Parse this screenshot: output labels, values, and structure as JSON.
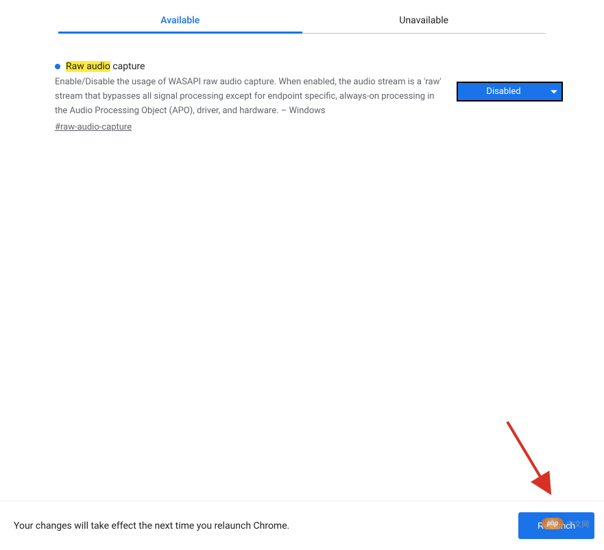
{
  "tabs": {
    "available": "Available",
    "unavailable": "Unavailable"
  },
  "flag": {
    "title_highlight": "Raw audio",
    "title_rest": " capture",
    "description": "Enable/Disable the usage of WASAPI raw audio capture. When enabled, the audio stream is a 'raw' stream that bypasses all signal processing except for endpoint specific, always-on processing in the Audio Processing Object (APO), driver, and hardware. – Windows",
    "anchor": "#raw-audio-capture",
    "selected_option": "Disabled"
  },
  "footer": {
    "message": "Your changes will take effect the next time you relaunch Chrome.",
    "button": "Relaunch"
  },
  "watermark": {
    "php": "php",
    "text": "中文网"
  }
}
